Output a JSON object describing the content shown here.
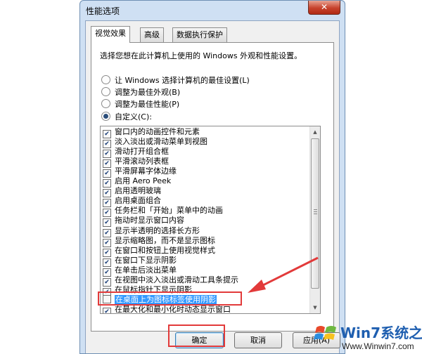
{
  "window": {
    "title": "性能选项",
    "close_glyph": "✕"
  },
  "tabs": [
    "视觉效果",
    "高级",
    "数据执行保护"
  ],
  "description": "选择您想在此计算机上使用的 Windows 外观和性能设置。",
  "radios": [
    {
      "label": "让 Windows 选择计算机的最佳设置(L)",
      "checked": false
    },
    {
      "label": "调整为最佳外观(B)",
      "checked": false
    },
    {
      "label": "调整为最佳性能(P)",
      "checked": false
    },
    {
      "label": "自定义(C):",
      "checked": true
    }
  ],
  "effects": [
    {
      "label": "窗口内的动画控件和元素",
      "checked": true
    },
    {
      "label": "淡入淡出或滑动菜单到视图",
      "checked": true
    },
    {
      "label": "滑动打开组合框",
      "checked": true
    },
    {
      "label": "平滑滚动列表框",
      "checked": true
    },
    {
      "label": "平滑屏幕字体边缘",
      "checked": true
    },
    {
      "label": "启用 Aero Peek",
      "checked": true
    },
    {
      "label": "启用透明玻璃",
      "checked": true
    },
    {
      "label": "启用桌面组合",
      "checked": true
    },
    {
      "label": "任务栏和「开始」菜单中的动画",
      "checked": true
    },
    {
      "label": "拖动时显示窗口内容",
      "checked": true
    },
    {
      "label": "显示半透明的选择长方形",
      "checked": true
    },
    {
      "label": "显示缩略图，而不是显示图标",
      "checked": true
    },
    {
      "label": "在窗口和按钮上使用视觉样式",
      "checked": true
    },
    {
      "label": "在窗口下显示阴影",
      "checked": true
    },
    {
      "label": "在单击后淡出菜单",
      "checked": true
    },
    {
      "label": "在视图中淡入淡出或滑动工具条提示",
      "checked": true
    },
    {
      "label": "在鼠标指针下显示阴影",
      "checked": true
    },
    {
      "label": "在桌面上为图标标签使用阴影",
      "checked": false,
      "selected": true
    },
    {
      "label": "在最大化和最小化时动态显示窗口",
      "checked": true
    }
  ],
  "buttons": {
    "ok": "确定",
    "cancel": "取消",
    "apply": "应用(A)"
  },
  "watermark": {
    "brand": "Win7系统之家",
    "url": "Www.Winwin7.com"
  },
  "colors": {
    "highlight": "#e23a3a",
    "selection": "#3399ff"
  },
  "icons": {
    "checkmark": "✔",
    "scroll_up": "▲",
    "scroll_down": "▼"
  }
}
